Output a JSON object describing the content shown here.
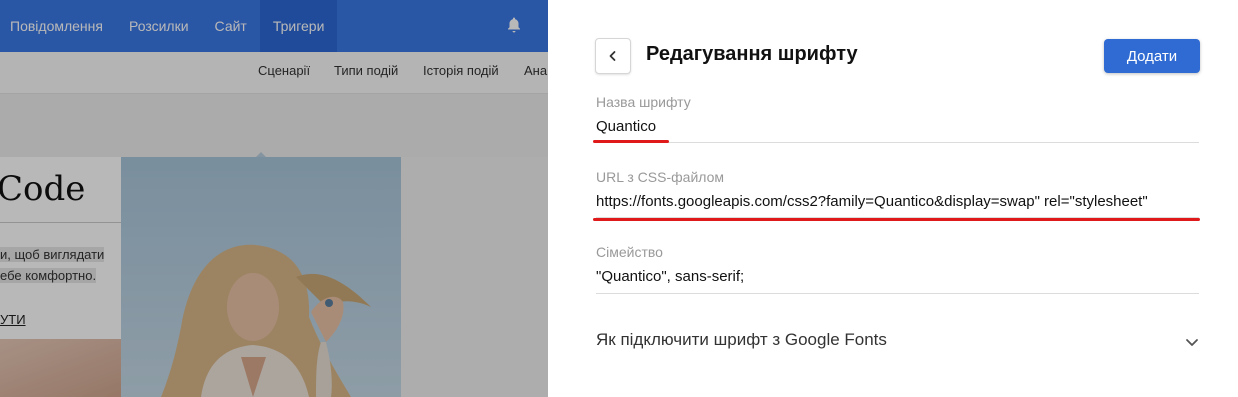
{
  "topnav": {
    "items": [
      {
        "label": "Повідомлення"
      },
      {
        "label": "Розсилки"
      },
      {
        "label": "Сайт"
      },
      {
        "label": "Тригери"
      }
    ],
    "bell_icon": "bell-icon"
  },
  "subnav": {
    "items": [
      {
        "label": "Сценарії"
      },
      {
        "label": "Типи подій"
      },
      {
        "label": "Історія подій"
      },
      {
        "label": "Ана"
      }
    ]
  },
  "preview": {
    "title": "Code",
    "snippet_line1": "и, щоб виглядати",
    "snippet_line2": "ебе комфортно.",
    "link": "УТИ"
  },
  "panel": {
    "title": "Редагування шрифту",
    "back_icon": "chevron-left-icon",
    "add_label": "Додати",
    "fields": {
      "name": {
        "label": "Назва шрифту",
        "value": "Quantico"
      },
      "url": {
        "label": "URL з CSS-файлом",
        "value": "https://fonts.googleapis.com/css2?family=Quantico&display=swap\" rel=\"stylesheet\""
      },
      "family": {
        "label": "Сімейство",
        "value": "\"Quantico\", sans-serif;"
      }
    },
    "accordion": {
      "label": "Як підключити шрифт з Google Fonts",
      "icon": "chevron-down-icon"
    }
  },
  "colors": {
    "nav_blue": "#3b78e7",
    "button_blue": "#2f6bd3",
    "highlight_red": "#e0191b"
  }
}
